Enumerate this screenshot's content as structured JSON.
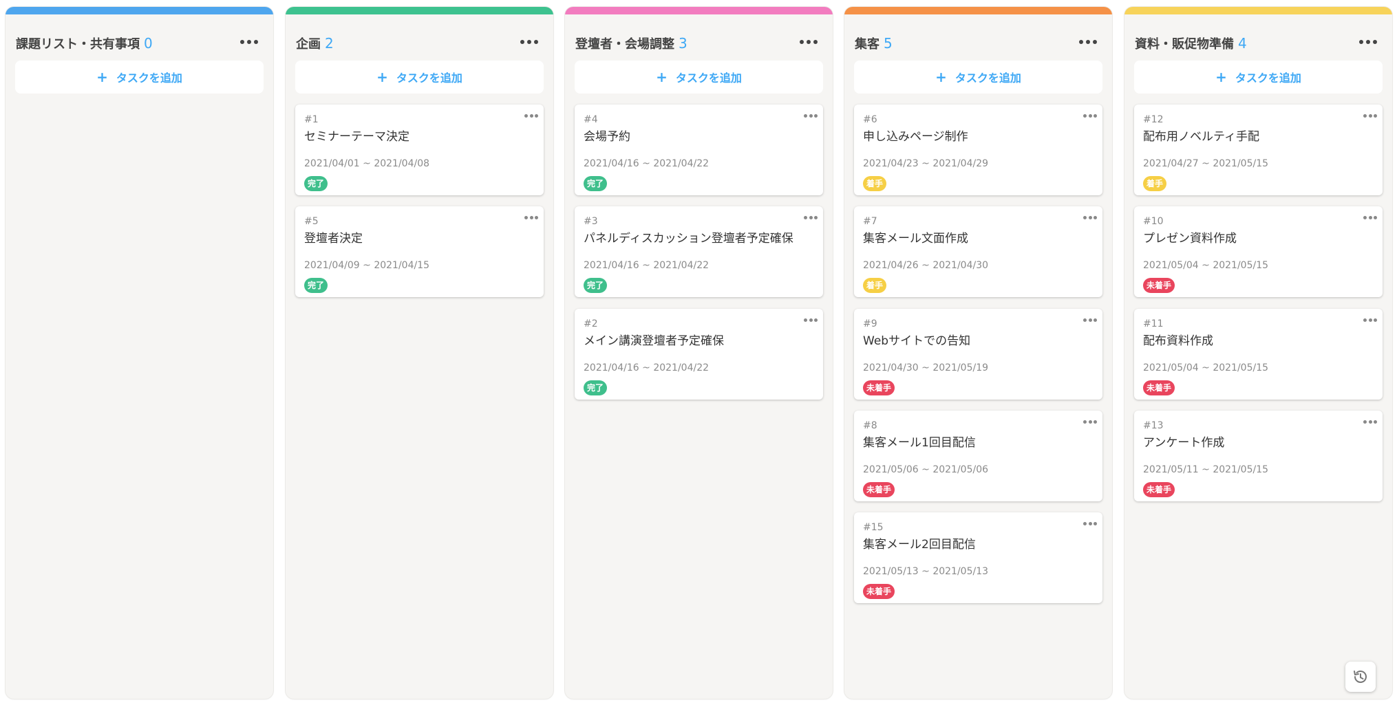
{
  "add_task_label": "タスクを追加",
  "columns": [
    {
      "title": "課題リスト・共有事項",
      "count": "0",
      "color": "#4ea6ee",
      "cards": []
    },
    {
      "title": "企画",
      "count": "2",
      "color": "#3dc28f",
      "cards": [
        {
          "num": "#1",
          "title": "セミナーテーマ決定",
          "dates": "2021/04/01 ~ 2021/04/08",
          "status": "完了"
        },
        {
          "num": "#5",
          "title": "登壇者決定",
          "dates": "2021/04/09 ~ 2021/04/15",
          "status": "完了"
        }
      ]
    },
    {
      "title": "登壇者・会場調整",
      "count": "3",
      "color": "#f27cbf",
      "cards": [
        {
          "num": "#4",
          "title": "会場予約",
          "dates": "2021/04/16 ~ 2021/04/22",
          "status": "完了"
        },
        {
          "num": "#3",
          "title": "パネルディスカッション登壇者予定確保",
          "dates": "2021/04/16 ~ 2021/04/22",
          "status": "完了"
        },
        {
          "num": "#2",
          "title": "メイン講演登壇者予定確保",
          "dates": "2021/04/16 ~ 2021/04/22",
          "status": "完了"
        }
      ]
    },
    {
      "title": "集客",
      "count": "5",
      "color": "#f59147",
      "cards": [
        {
          "num": "#6",
          "title": "申し込みページ制作",
          "dates": "2021/04/23 ~ 2021/04/29",
          "status": "着手"
        },
        {
          "num": "#7",
          "title": "集客メール文面作成",
          "dates": "2021/04/26 ~ 2021/04/30",
          "status": "着手"
        },
        {
          "num": "#9",
          "title": "Webサイトでの告知",
          "dates": "2021/04/30 ~ 2021/05/19",
          "status": "未着手"
        },
        {
          "num": "#8",
          "title": "集客メール1回目配信",
          "dates": "2021/05/06 ~ 2021/05/06",
          "status": "未着手"
        },
        {
          "num": "#15",
          "title": "集客メール2回目配信",
          "dates": "2021/05/13 ~ 2021/05/13",
          "status": "未着手"
        }
      ]
    },
    {
      "title": "資料・販促物準備",
      "count": "4",
      "color": "#f7d35a",
      "cards": [
        {
          "num": "#12",
          "title": "配布用ノベルティ手配",
          "dates": "2021/04/27 ~ 2021/05/15",
          "status": "着手"
        },
        {
          "num": "#10",
          "title": "プレゼン資料作成",
          "dates": "2021/05/04 ~ 2021/05/15",
          "status": "未着手"
        },
        {
          "num": "#11",
          "title": "配布資料作成",
          "dates": "2021/05/04 ~ 2021/05/15",
          "status": "未着手"
        },
        {
          "num": "#13",
          "title": "アンケート作成",
          "dates": "2021/05/11 ~ 2021/05/15",
          "status": "未着手"
        }
      ]
    }
  ],
  "status_colors": {
    "完了": "#3fbf8c",
    "着手": "#f6cf45",
    "未着手": "#e9455d"
  },
  "history_icon": "history-icon"
}
